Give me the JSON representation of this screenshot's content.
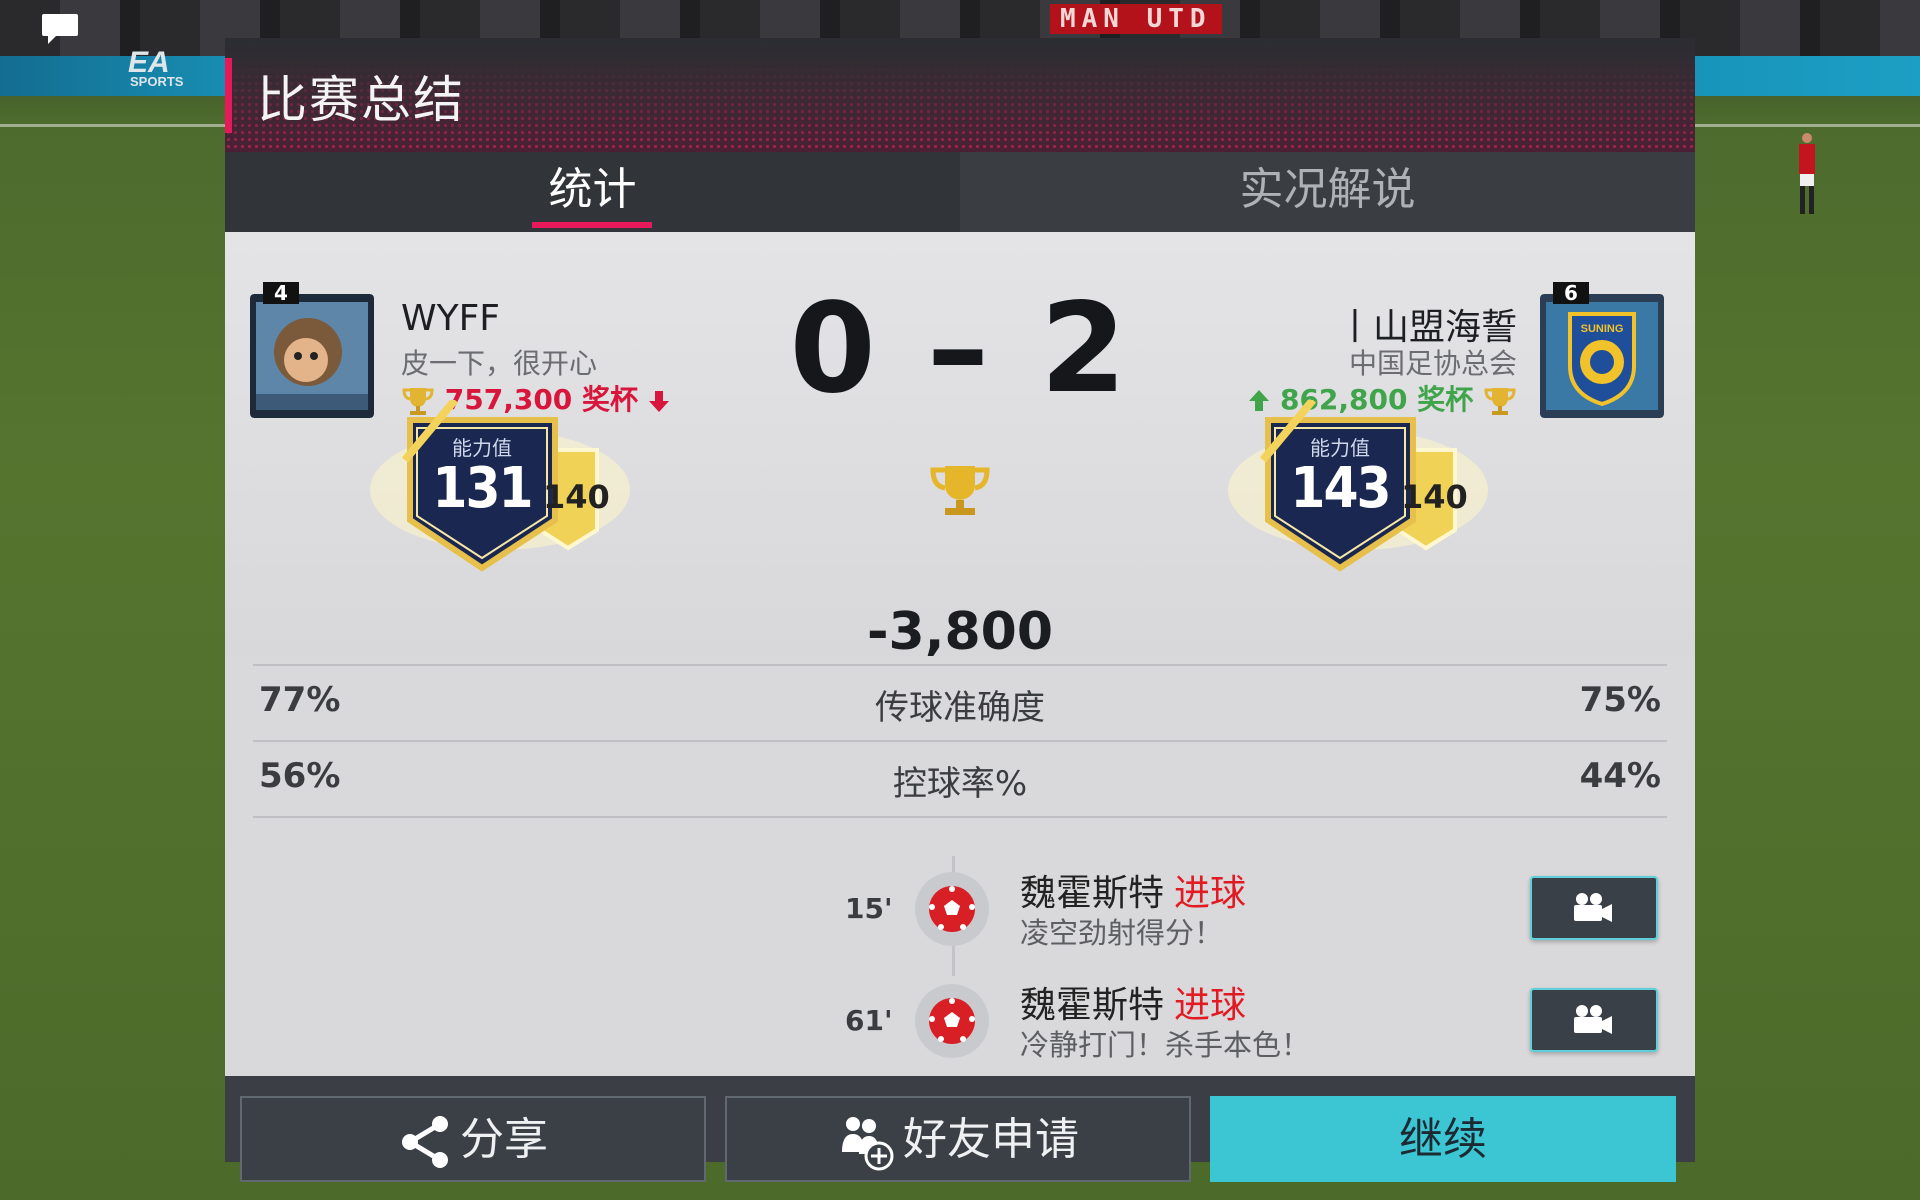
{
  "header": {
    "title": "比赛总结"
  },
  "tabs": [
    {
      "label": "统计",
      "active": true
    },
    {
      "label": "实况解说",
      "active": false
    }
  ],
  "home": {
    "level": "4",
    "name": "WYFF",
    "subtitle": "皮一下，很开心",
    "trophies": "757,300 奖杯",
    "trend": "down",
    "rating_label": "能力值",
    "rating": "131",
    "rating_side": "140"
  },
  "away": {
    "level": "6",
    "name": "丨山盟海誓",
    "subtitle": "中国足协总会",
    "trophies": "862,800 奖杯",
    "trend": "up",
    "rating_label": "能力值",
    "rating": "143",
    "rating_side": "140",
    "badge_text": "SUNING"
  },
  "score": {
    "text": "0 – 2",
    "home": 0,
    "away": 2
  },
  "trophy_delta": "-3,800",
  "stats": [
    {
      "left": "77%",
      "label": "传球准确度",
      "right": "75%"
    },
    {
      "left": "56%",
      "label": "控球率%",
      "right": "44%"
    }
  ],
  "goals": [
    {
      "minute": "15'",
      "player": "魏霍斯特",
      "tag": "进球",
      "desc": "凌空劲射得分！"
    },
    {
      "minute": "61'",
      "player": "魏霍斯特",
      "tag": "进球",
      "desc": "冷静打门！杀手本色！"
    }
  ],
  "footer": {
    "share": "分享",
    "friend": "好友申请",
    "continue": "继续"
  },
  "background": {
    "banner_text": "MAN UTD",
    "ea_logo": "EA",
    "ea_sports": "SPORTS"
  },
  "colors": {
    "accent": "#e8195a",
    "continue": "#3cc6d3",
    "down": "#d8163c",
    "up": "#3fa44a",
    "goal_tag": "#e21b23"
  },
  "icons": {
    "chat": "chat-bubble-icon",
    "trophy": "trophy-icon",
    "trend_down": "arrow-down-icon",
    "trend_up": "arrow-up-icon",
    "ball": "soccer-ball-icon",
    "camera": "video-camera-icon",
    "share": "share-icon",
    "friend": "add-friend-icon"
  }
}
